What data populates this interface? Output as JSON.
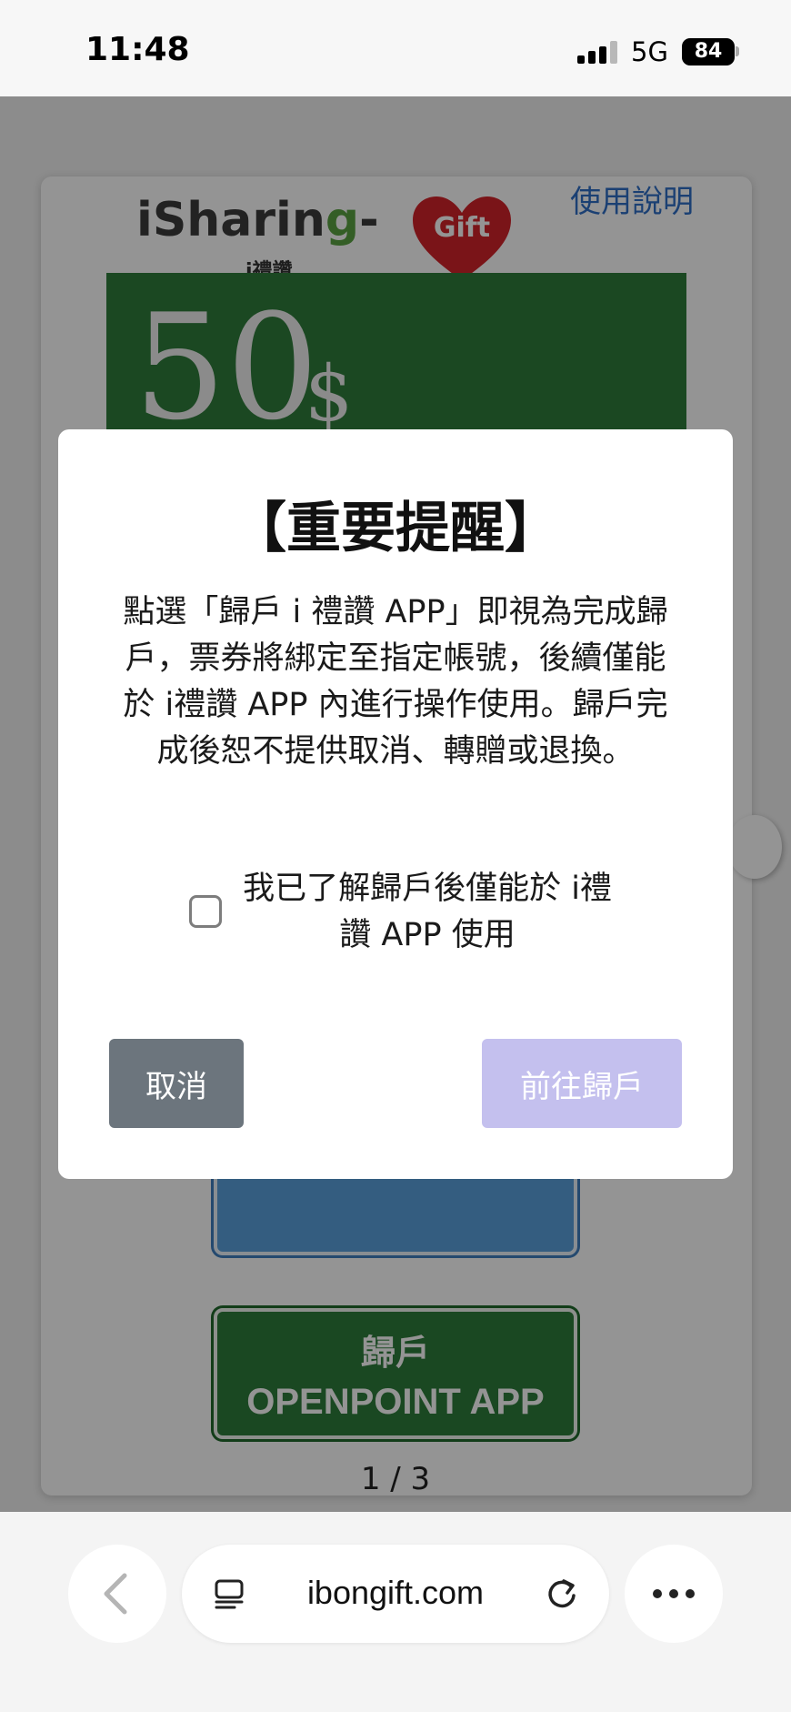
{
  "status_bar": {
    "time": "11:48",
    "network": "5G",
    "battery": "84"
  },
  "page": {
    "logo_text_1": "iSharin",
    "logo_text_2": "g",
    "logo_text_3": "-",
    "logo_heart_text": "Gift",
    "logo_sub": "i禮讚",
    "help_link": "使用說明",
    "gift_amount": "50",
    "gift_currency": "$",
    "redeem_openpoint_line1": "歸戶",
    "redeem_openpoint_line2": "OPENPOINT APP",
    "pager": "1 / 3"
  },
  "modal": {
    "title": "【重要提醒】",
    "body": "點選「歸戶 i 禮讚 APP」即視為完成歸戶，票券將綁定至指定帳號，後續僅能於 i禮讚 APP 內進行操作使用。歸戶完成後恕不提供取消、轉贈或退換。",
    "confirm_label": "我已了解歸戶後僅能於 i禮讚 APP 使用",
    "confirm_checked": false,
    "cancel_label": "取消",
    "proceed_label": "前往歸戶"
  },
  "browser": {
    "url": "ibongift.com"
  },
  "colors": {
    "cancel_button": "#6c757d",
    "proceed_button_disabled": "#c4c0ee",
    "gift_card_green": "#2f7d3c",
    "link_blue": "#2f6fc7"
  }
}
